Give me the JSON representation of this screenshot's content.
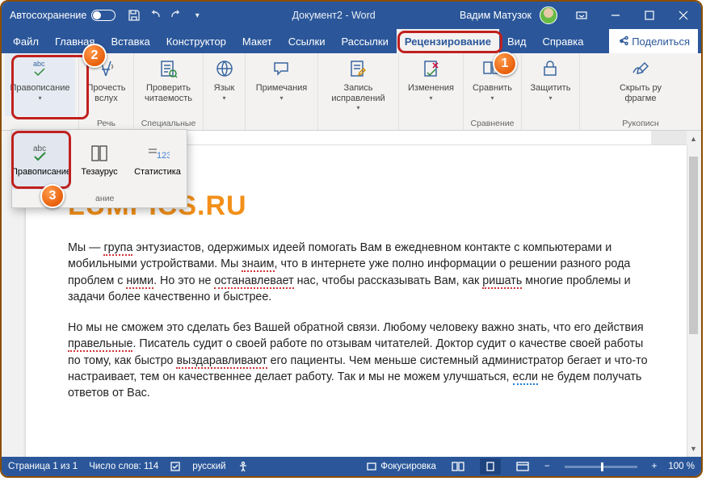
{
  "titlebar": {
    "autosave": "Автосохранение",
    "doc": "Документ2 - Word",
    "user": "Вадим Матузок"
  },
  "tabs": [
    "Файл",
    "Главная",
    "Вставка",
    "Конструктор",
    "Макет",
    "Ссылки",
    "Рассылки",
    "Рецензирование",
    "Вид",
    "Справка"
  ],
  "active_tab": 7,
  "share": "Поделиться",
  "ribbon": {
    "spelling": "Правописание",
    "read_aloud": "Прочесть\nвслух",
    "readability": "Проверить\nчитаемость",
    "language": "Язык",
    "comments": "Примечания",
    "track": "Запись\nисправлений",
    "changes": "Изменения",
    "compare": "Сравнить",
    "protect": "Защитить",
    "ink_hide": "Скрыть ру\nфрагме",
    "caps": {
      "speech": "Речь",
      "special": "Специальные",
      "compare": "Сравнение",
      "ink": "Рукописн"
    }
  },
  "dropdown": {
    "spelling_g": "Правописание",
    "thesaurus": "Тезаурус",
    "stats": "Статистика",
    "cap": "ание"
  },
  "doc": {
    "brand": "LUMPICS.RU",
    "p1_a": "Мы — ",
    "p1_sp1": "група",
    "p1_b": " энтузиастов, одержимых идеей помогать Вам в ежедневном контакте с компьютерами и мобильными устройствами. Мы ",
    "p1_sp2": "знаим",
    "p1_c": ", что в интернете уже полно информации о решении разного рода проблем с ",
    "p1_sp3": "ними",
    "p1_d": ". Но это не ",
    "p1_sp4": "останавлевает",
    "p1_e": " нас, чтобы рассказывать Вам, как ",
    "p1_sp5": "ришать",
    "p1_f": " многие проблемы и задачи более качественно и быстрее.",
    "p2_a": "Но мы не сможем это сделать без Вашей обратной связи. Любому человеку важно знать, что его действия ",
    "p2_sp1": "правельные",
    "p2_b": ". Писатель судит о своей работе по отзывам читателей. Доктор судит о качестве своей работы по тому, как быстро ",
    "p2_sp2": "выздаравливают",
    "p2_c": " его пациенты. Чем меньше системный администратор бегает и что-то настраивает, тем он качественнее делает работу. Так и мы не можем улучшаться, ",
    "p2_sp3": "если",
    "p2_d": " не будем получать ответов от Вас."
  },
  "status": {
    "page": "Страница 1 из 1",
    "words": "Число слов: 114",
    "lang": "русский",
    "focus": "Фокусировка",
    "zoom": "100 %"
  },
  "badges": {
    "b1": "1",
    "b2": "2",
    "b3": "3"
  }
}
